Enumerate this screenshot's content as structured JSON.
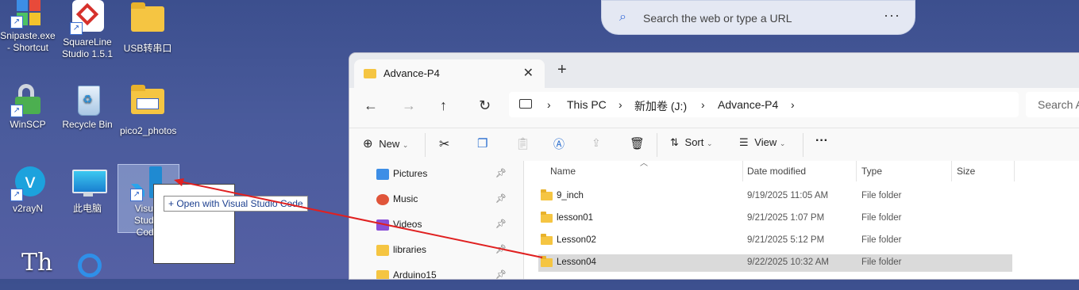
{
  "desktop": {
    "icons": [
      {
        "label": "Snipaste.exe - Shortcut"
      },
      {
        "label": "SquareLine Studio 1.5.1"
      },
      {
        "label": "USB转串口"
      },
      {
        "label": "WinSCP"
      },
      {
        "label": "Recycle Bin"
      },
      {
        "label": "pico2_photos"
      },
      {
        "label": "v2rayN"
      },
      {
        "label": "此电脑"
      },
      {
        "label": "Visual Studio Code"
      }
    ],
    "drag_tooltip": "+ Open with Visual Studio Code"
  },
  "browser_search": {
    "placeholder": "Search the web or type a URL",
    "more": "···"
  },
  "explorer": {
    "tab_title": "Advance-P4",
    "breadcrumb": [
      "This PC",
      "新加卷 (J:)",
      "Advance-P4"
    ],
    "search_placeholder": "Search A",
    "commands": {
      "new": "New",
      "sort": "Sort",
      "view": "View",
      "more": "···"
    },
    "nav_items": [
      {
        "label": "Pictures",
        "color": "#3d8ee6"
      },
      {
        "label": "Music",
        "color": "#e0553a"
      },
      {
        "label": "Videos",
        "color": "#8a4fd8"
      },
      {
        "label": "libraries",
        "color": "#f5c542"
      },
      {
        "label": "Arduino15",
        "color": "#f5c542"
      }
    ],
    "columns": {
      "name": "Name",
      "date": "Date modified",
      "type": "Type",
      "size": "Size"
    },
    "files": [
      {
        "name": "9_inch",
        "date": "9/19/2025 11:05 AM",
        "type": "File folder"
      },
      {
        "name": "lesson01",
        "date": "9/21/2025 1:07 PM",
        "type": "File folder"
      },
      {
        "name": "Lesson02",
        "date": "9/21/2025 5:12 PM",
        "type": "File folder"
      },
      {
        "name": "Lesson04",
        "date": "9/22/2025 10:32 AM",
        "type": "File folder"
      }
    ]
  }
}
